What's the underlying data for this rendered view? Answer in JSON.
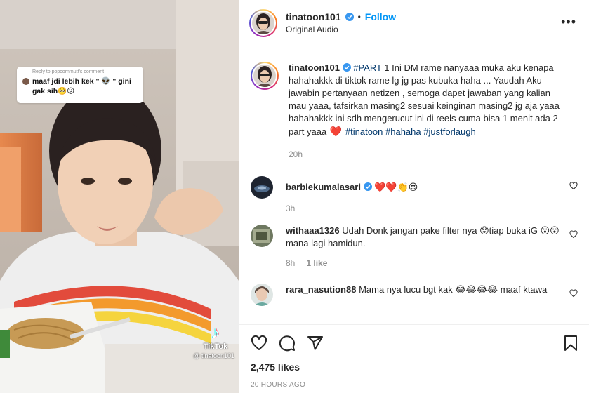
{
  "post": {
    "username": "tinatoon101",
    "verified": true,
    "follow_label": "Follow",
    "dot": "•",
    "audio": "Original Audio",
    "more_label": "•••"
  },
  "media": {
    "reply_header": "Reply to popcornmutt's comment",
    "reply_text": "maaf jdi lebih kek \" 👽 \" gini gak sih🥺😕",
    "tiktok_label": "TikTok",
    "tiktok_handle": "@ tinatoon101"
  },
  "caption": {
    "username": "tinatoon101",
    "tag_part": "#PART",
    "text": " 1 Ini DM rame nanyaaa muka aku kenapa hahahakkk di tiktok rame lg jg pas kubuka haha ... Yaudah Aku jawabin pertanyaan netizen , semoga dapet jawaban yang kalian mau yaaa, tafsirkan masing2 sesuai keinginan masing2 jg aja yaaa hahahakkk ini sdh mengerucut ini di reels cuma bisa 1 menit ada 2 part yaaa ",
    "heart": "❤️",
    "tags": [
      "#tinatoon",
      "#hahaha",
      "#justforlaugh"
    ],
    "time": "20h"
  },
  "comments": [
    {
      "username": "barbiekumalasari",
      "text": "❤️❤️👏😍",
      "time": "3h",
      "likes": ""
    },
    {
      "username": "withaaa1326",
      "text": "Udah Donk jangan pake filter nya 😟tiap buka iG 😮😮mana lagi hamidun.",
      "time": "8h",
      "likes": "1 like"
    },
    {
      "username": "rara_nasution88",
      "text": "Mama nya lucu bgt kak 😂😂😂😂 maaf ktawa",
      "time": "",
      "likes": ""
    }
  ],
  "footer": {
    "likes": "2,475 likes",
    "date": "20 HOURS AGO"
  },
  "colors": {
    "accent": "#0095f6",
    "verified": "#3897f0",
    "hashtag": "#00376b",
    "muted": "#8e8e8e"
  },
  "icons": [
    "heart-icon",
    "comment-icon",
    "share-icon",
    "bookmark-icon",
    "more-icon",
    "verified-icon"
  ]
}
